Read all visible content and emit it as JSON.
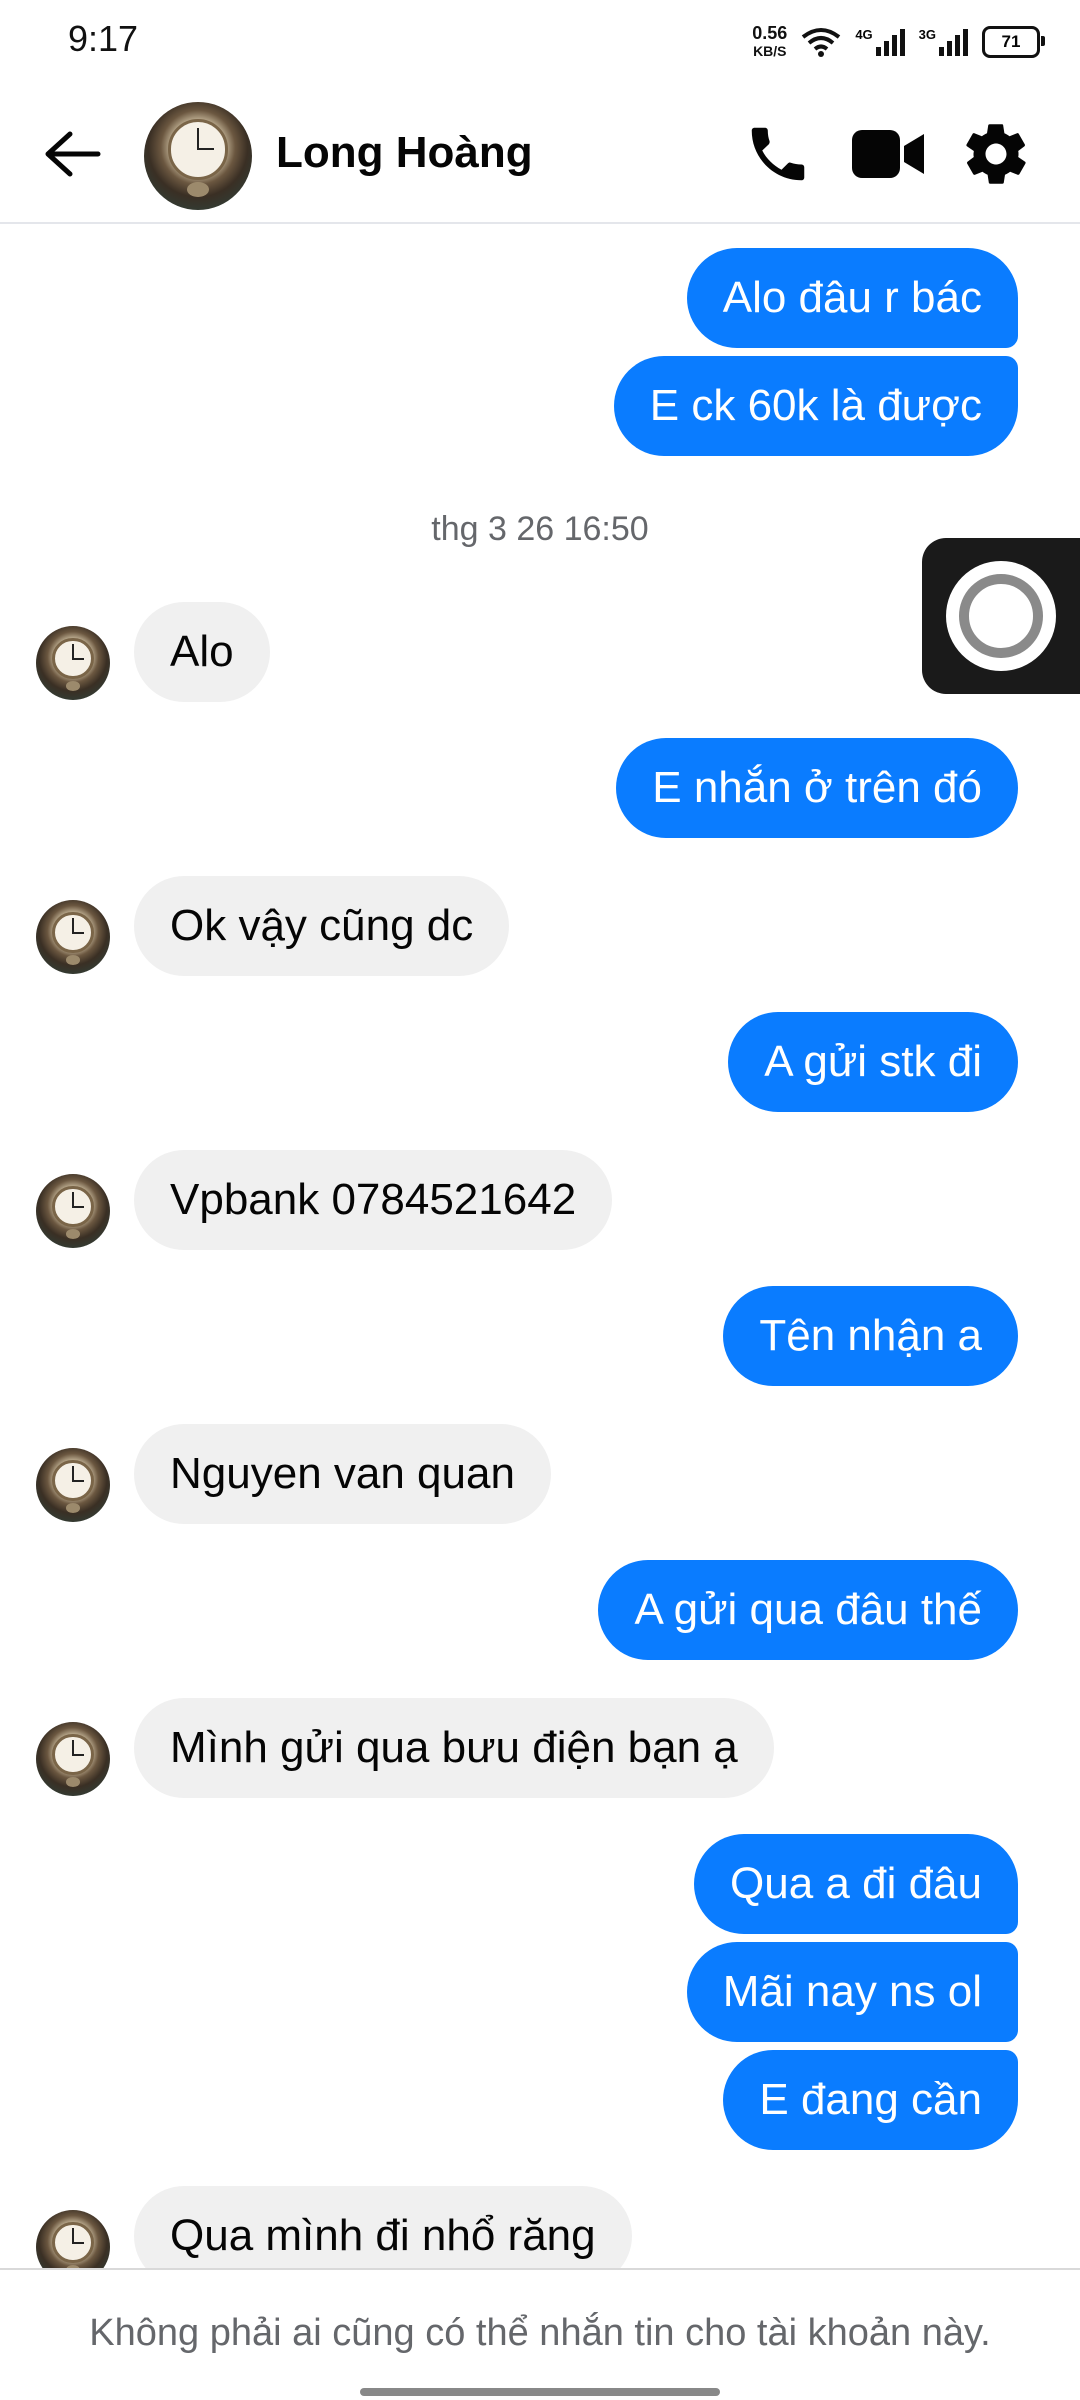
{
  "status_bar": {
    "time": "9:17",
    "net_speed": "0.56",
    "net_speed_unit": "KB/S",
    "signal1_label": "4G",
    "signal2_label": "3G",
    "battery": "71"
  },
  "header": {
    "contact_name": "Long Hoàng",
    "back_icon": "arrow-left-icon",
    "call_icon": "phone-icon",
    "video_icon": "video-camera-icon",
    "settings_icon": "gear-icon",
    "accent_color": "#0a7cff"
  },
  "chat": {
    "outgoing_color": "#0a7cff",
    "incoming_color": "#f0f0f0",
    "messages": [
      {
        "dir": "out",
        "text": "Alo đâu r bác"
      },
      {
        "dir": "out",
        "text": "E ck 60k là được"
      },
      {
        "dir": "time",
        "text": "thg 3 26 16:50"
      },
      {
        "dir": "in",
        "text": "Alo"
      },
      {
        "dir": "out",
        "text": "E nhắn ở trên đó"
      },
      {
        "dir": "in",
        "text": "Ok vậy cũng dc"
      },
      {
        "dir": "out",
        "text": "A gửi stk đi"
      },
      {
        "dir": "in",
        "text": "Vpbank 0784521642"
      },
      {
        "dir": "out",
        "text": "Tên nhận a"
      },
      {
        "dir": "in",
        "text": "Nguyen van quan"
      },
      {
        "dir": "out",
        "text": "A gửi qua đâu thế"
      },
      {
        "dir": "in",
        "text": "Mình gửi qua bưu điện bạn ạ"
      },
      {
        "dir": "out",
        "text": "Qua a đi đâu"
      },
      {
        "dir": "out",
        "text": "Mãi nay ns ol"
      },
      {
        "dir": "out",
        "text": "E đang cần"
      },
      {
        "dir": "in",
        "text": "Qua mình đi nhổ răng"
      }
    ]
  },
  "footer": {
    "notice": "Không phải ai cũng có thể nhắn tin cho tài khoản này."
  }
}
